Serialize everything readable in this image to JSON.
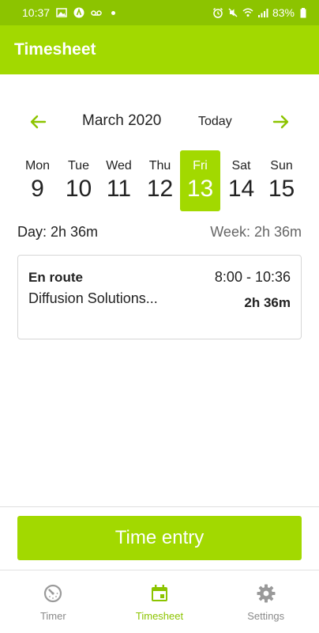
{
  "status_bar": {
    "time": "10:37",
    "battery": "83%",
    "icons": [
      "image-icon",
      "app-notification-icon",
      "voicemail-icon",
      "notification-dot-icon",
      "alarm-icon",
      "mute-icon",
      "wifi-icon",
      "signal-icon",
      "battery-icon"
    ]
  },
  "app_bar": {
    "title": "Timesheet"
  },
  "calendar": {
    "month_label": "March 2020",
    "today_label": "Today",
    "prev_icon": "arrow-left-icon",
    "next_icon": "arrow-right-icon",
    "days": [
      {
        "name": "Mon",
        "num": "9"
      },
      {
        "name": "Tue",
        "num": "10"
      },
      {
        "name": "Wed",
        "num": "11"
      },
      {
        "name": "Thu",
        "num": "12"
      },
      {
        "name": "Fri",
        "num": "13"
      },
      {
        "name": "Sat",
        "num": "14"
      },
      {
        "name": "Sun",
        "num": "15"
      }
    ],
    "selected_day": "Fri"
  },
  "totals": {
    "day": "Day: 2h 36m",
    "week": "Week: 2h 36m"
  },
  "entries": [
    {
      "activity": "En route",
      "time_range": "8:00 - 10:36",
      "project": "Diffusion Solutions...",
      "duration": "2h 36m"
    }
  ],
  "actions": {
    "time_entry_label": "Time entry"
  },
  "bottom_nav": {
    "items": [
      {
        "label": "Timer",
        "icon": "timer-icon"
      },
      {
        "label": "Timesheet",
        "icon": "calendar-icon"
      },
      {
        "label": "Settings",
        "icon": "gear-icon"
      }
    ],
    "active": "Timesheet"
  },
  "colors": {
    "accent": "#a2d900",
    "status_bar": "#8cc400",
    "inactive": "#8a8a8a"
  }
}
